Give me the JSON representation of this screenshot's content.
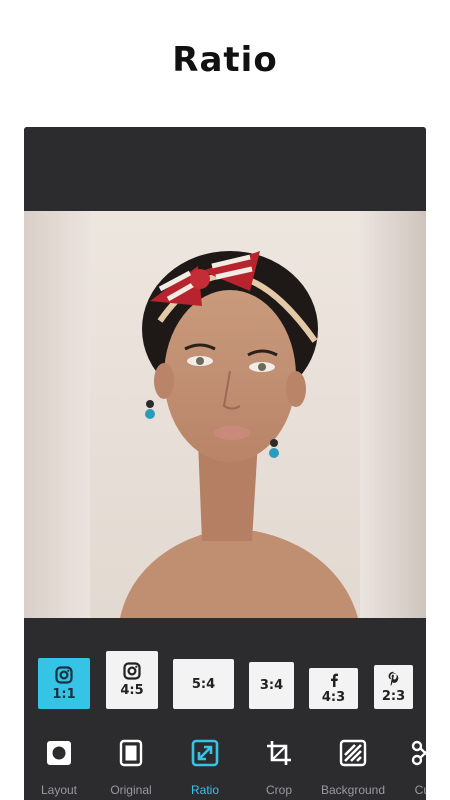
{
  "screen_title": "Ratio",
  "ratios": [
    {
      "label": "1:1",
      "icon": "instagram-icon",
      "active": true
    },
    {
      "label": "4:5",
      "icon": "instagram-icon",
      "active": false
    },
    {
      "label": "5:4",
      "icon": "",
      "active": false
    },
    {
      "label": "3:4",
      "icon": "",
      "active": false
    },
    {
      "label": "4:3",
      "icon": "facebook-icon",
      "active": false
    },
    {
      "label": "2:3",
      "icon": "pinterest-icon",
      "active": false
    }
  ],
  "toolbar": [
    {
      "label": "Layout",
      "icon": "layout-icon",
      "active": false
    },
    {
      "label": "Original",
      "icon": "original-icon",
      "active": false
    },
    {
      "label": "Ratio",
      "icon": "ratio-icon",
      "active": true
    },
    {
      "label": "Crop",
      "icon": "crop-icon",
      "active": false
    },
    {
      "label": "Background",
      "icon": "background-icon",
      "active": false
    },
    {
      "label": "Cut",
      "icon": "cut-icon",
      "active": false
    }
  ],
  "colors": {
    "accent": "#35c3e6",
    "panel": "#2c2c2f"
  }
}
